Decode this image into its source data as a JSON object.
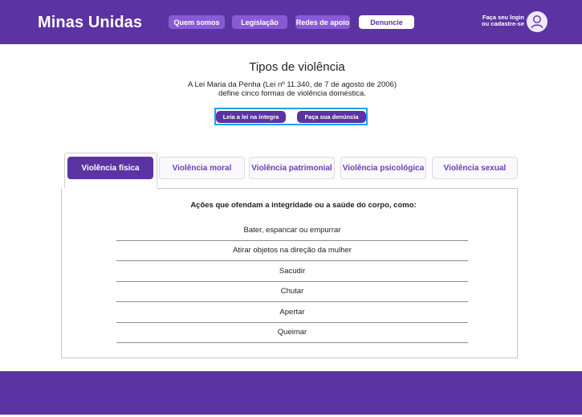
{
  "header": {
    "brand": "Minas Unidas",
    "nav": [
      {
        "label": "Quem somos"
      },
      {
        "label": "Legislação"
      },
      {
        "label": "Redes de apoio"
      },
      {
        "label": "Denuncie"
      }
    ],
    "login_line1": "Faça seu login",
    "login_line2": "ou cadastre-se",
    "avatar_icon": "user-avatar-icon"
  },
  "intro": {
    "title": "Tipos de violência",
    "line1": "A Lei Maria da Penha (Lei nº 11.340, de 7 de agosto de 2006)",
    "line2": "define cinco formas de violência doméstica.",
    "buttons": [
      {
        "label": "Leia a lei na íntegra"
      },
      {
        "label": "Faça sua denúncia"
      }
    ]
  },
  "tabs": [
    {
      "label": "Violência física",
      "active": true
    },
    {
      "label": "Violência moral",
      "active": false
    },
    {
      "label": "Violência patrimonial",
      "active": false
    },
    {
      "label": "Violência psicológica",
      "active": false
    },
    {
      "label": "Violência sexual",
      "active": false
    }
  ],
  "panel": {
    "heading": "Ações que ofendam a integridade ou a saúde do corpo, como:",
    "items": [
      "Bater, espancar ou empurrar",
      "Atirar objetos na direção da mulher",
      "Sacudir",
      "Chutar",
      "Apertar",
      "Queimar"
    ]
  },
  "colors": {
    "primary": "#5b33a2",
    "accent": "#8a5ad6",
    "focus_outline": "#1ea0f0"
  }
}
